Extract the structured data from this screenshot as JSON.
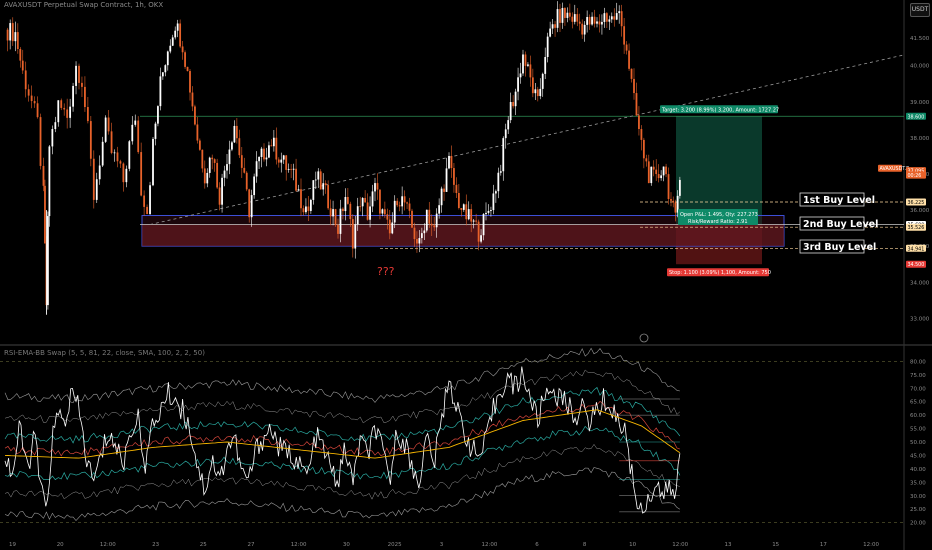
{
  "header": {
    "symbol_title": "AVAXUSDT Perpetual Swap Contract, 1h, OKX",
    "unit": "USDT",
    "indicator_title": "RSI-EMA-BB Swap (5, 5, 81, 22, close, SMA, 100, 2, 2, 50)"
  },
  "colors": {
    "background": "#000000",
    "candle_up": "#ffffff",
    "candle_down": "#e8622a",
    "target_zone": "#0b3f30",
    "target_label_bg": "#0f8a68",
    "stop_zone": "#5a1414",
    "stop_label_bg": "#e53935",
    "buy_zone_border": "#3d4fd6",
    "annotation_red": "#e53935",
    "rsi_line": "#ffffff",
    "basis_line": "#f5b400",
    "band_inner": "#2aa9a0",
    "band_outer": "#9a9a9a",
    "band_red": "#d2453a"
  },
  "price_axis": {
    "ticks": [
      "40.000",
      "39.000",
      "38.000",
      "37.000",
      "36.000",
      "35.000",
      "34.000",
      "33.000"
    ],
    "top_marker": "41.500",
    "badges": [
      {
        "label": "38.600",
        "price": 38.6,
        "color": "#0f8a68",
        "text_color": "#ffffff"
      },
      {
        "label": "AVAXUSDT.P",
        "price": 37.16,
        "color": "#e8622a",
        "text_color": "#ffffff"
      },
      {
        "label": "37.095",
        "price": 37.095,
        "color": "#e8622a",
        "text_color": "#ffffff"
      },
      {
        "label": "00:26",
        "price": 36.97,
        "color": "#e8622a",
        "text_color": "#ffffff"
      },
      {
        "label": "36.225",
        "price": 36.225,
        "color": "#ffe0a8",
        "text_color": "#000000"
      },
      {
        "label": "35.600",
        "price": 35.6,
        "color": "#ffffff",
        "text_color": "#000000"
      },
      {
        "label": "35.526",
        "price": 35.526,
        "color": "#ffe0a8",
        "text_color": "#000000"
      },
      {
        "label": "34.941",
        "price": 34.941,
        "color": "#ffe0a8",
        "text_color": "#000000"
      },
      {
        "label": "34.500",
        "price": 34.5,
        "color": "#e53935",
        "text_color": "#ffffff"
      }
    ]
  },
  "indicator_axis": {
    "ticks": [
      "80.00",
      "75.00",
      "70.00",
      "65.00",
      "60.00",
      "55.00",
      "50.00",
      "45.00",
      "40.00",
      "35.00",
      "30.00",
      "25.00",
      "20.00"
    ]
  },
  "time_axis": {
    "ticks": [
      "19",
      "20",
      "12:00",
      "23",
      "25",
      "27",
      "12:00",
      "30",
      "2025",
      "3",
      "12:00",
      "6",
      "8",
      "10",
      "12:00",
      "13",
      "15",
      "17",
      "12:00"
    ]
  },
  "annotations": {
    "target_label": "Target: 3.200 (8.99%) 3,200, Amount: 1727.27",
    "stop_label": "Stop: 1.100 (3.09%) 1,100, Amount: 750",
    "position_label_line1": "Open P&L: 1.495, Qty: 227.273",
    "position_label_line2": "Risk/Reward Ratio: 2.91",
    "buy_level_1": "1st Buy Level",
    "buy_level_2": "2nd Buy Level",
    "buy_level_3": "3rd Buy Level",
    "question_marks": "???",
    "entry_price": 35.6,
    "target_price": 38.6,
    "stop_price": 34.5,
    "buy_level_1_price": 36.225,
    "buy_level_2_price": 35.526,
    "buy_level_3_price": 34.941,
    "zone_top_price": 35.85,
    "zone_bottom_price": 35.0
  },
  "chart_data": [
    {
      "type": "candlestick",
      "title": "AVAXUSDT Perpetual Swap Contract, 1h, OKX",
      "ylim": [
        32.4,
        41.6
      ],
      "x_categories": [
        "19",
        "20",
        "12:00",
        "23",
        "25",
        "27",
        "12:00",
        "30",
        "2025",
        "3",
        "12:00",
        "6",
        "8",
        "10",
        "12:00",
        "13",
        "15",
        "17",
        "12:00"
      ],
      "close_path": [
        [
          0,
          41.0
        ],
        [
          0.07,
          40.9
        ],
        [
          0.12,
          39.8
        ],
        [
          0.18,
          39.0
        ],
        [
          0.22,
          38.4
        ],
        [
          0.26,
          36.4
        ],
        [
          0.28,
          33.4
        ],
        [
          0.3,
          37.8
        ],
        [
          0.36,
          38.9
        ],
        [
          0.42,
          38.6
        ],
        [
          0.48,
          40.0
        ],
        [
          0.52,
          39.6
        ],
        [
          0.56,
          38.2
        ],
        [
          0.6,
          36.4
        ],
        [
          0.64,
          37.4
        ],
        [
          0.68,
          38.3
        ],
        [
          0.72,
          37.6
        ],
        [
          0.76,
          37.3
        ],
        [
          0.8,
          36.8
        ],
        [
          0.84,
          37.8
        ],
        [
          0.88,
          38.6
        ],
        [
          0.92,
          36.6
        ],
        [
          0.96,
          36.0
        ],
        [
          1.0,
          37.8
        ],
        [
          1.05,
          39.5
        ],
        [
          1.1,
          40.5
        ],
        [
          1.15,
          41.2
        ],
        [
          1.2,
          40.6
        ],
        [
          1.25,
          39.4
        ],
        [
          1.3,
          38.0
        ],
        [
          1.35,
          37.0
        ],
        [
          1.4,
          37.6
        ],
        [
          1.45,
          36.4
        ],
        [
          1.5,
          37.5
        ],
        [
          1.55,
          38.4
        ],
        [
          1.6,
          37.2
        ],
        [
          1.65,
          36.0
        ],
        [
          1.7,
          37.2
        ],
        [
          1.75,
          37.6
        ],
        [
          1.8,
          37.9
        ],
        [
          1.85,
          37.5
        ],
        [
          1.9,
          37.2
        ],
        [
          1.95,
          36.9
        ],
        [
          2.0,
          36.3
        ],
        [
          2.05,
          36.0
        ],
        [
          2.1,
          36.9
        ],
        [
          2.15,
          36.6
        ],
        [
          2.2,
          36.1
        ],
        [
          2.25,
          35.5
        ],
        [
          2.3,
          36.4
        ],
        [
          2.35,
          35.2
        ],
        [
          2.4,
          36.3
        ],
        [
          2.45,
          35.9
        ],
        [
          2.5,
          36.6
        ],
        [
          2.55,
          35.9
        ],
        [
          2.6,
          35.3
        ],
        [
          2.65,
          36.4
        ],
        [
          2.7,
          36.2
        ],
        [
          2.75,
          35.5
        ],
        [
          2.8,
          35.0
        ],
        [
          2.85,
          36.0
        ],
        [
          2.9,
          35.4
        ],
        [
          2.95,
          36.5
        ],
        [
          3.0,
          37.3
        ],
        [
          3.05,
          36.4
        ],
        [
          3.1,
          35.9
        ],
        [
          3.15,
          35.7
        ],
        [
          3.2,
          35.4
        ],
        [
          3.25,
          35.8
        ],
        [
          3.3,
          36.4
        ],
        [
          3.35,
          37.3
        ],
        [
          3.4,
          38.6
        ],
        [
          3.45,
          39.3
        ],
        [
          3.5,
          40.3
        ],
        [
          3.55,
          39.6
        ],
        [
          3.6,
          38.9
        ],
        [
          3.65,
          40.4
        ],
        [
          3.7,
          41.1
        ],
        [
          3.75,
          41.4
        ],
        [
          3.8,
          41.4
        ],
        [
          3.85,
          41.3
        ],
        [
          3.9,
          41.1
        ],
        [
          3.95,
          41.2
        ],
        [
          4.0,
          41.1
        ],
        [
          4.05,
          41.4
        ],
        [
          4.1,
          41.3
        ],
        [
          4.15,
          41.4
        ],
        [
          4.2,
          40.5
        ],
        [
          4.25,
          39.0
        ],
        [
          4.3,
          37.8
        ],
        [
          4.35,
          37.0
        ],
        [
          4.4,
          36.8
        ],
        [
          4.45,
          37.3
        ],
        [
          4.5,
          36.2
        ],
        [
          4.53,
          35.7
        ],
        [
          4.56,
          37.1
        ]
      ]
    },
    {
      "type": "line",
      "title": "RSI-EMA-BB Swap (5, 5, 81, 22, close, SMA, 100, 2, 2, 50)",
      "ylim": [
        18,
        82
      ],
      "series": [
        {
          "name": "RSI",
          "color": "#ffffff",
          "points": [
            [
              0,
              45
            ],
            [
              0.05,
              38
            ],
            [
              0.1,
              55
            ],
            [
              0.15,
              40
            ],
            [
              0.2,
              52
            ],
            [
              0.25,
              30
            ],
            [
              0.28,
              24
            ],
            [
              0.32,
              52
            ],
            [
              0.36,
              60
            ],
            [
              0.4,
              57
            ],
            [
              0.45,
              68
            ],
            [
              0.5,
              62
            ],
            [
              0.55,
              44
            ],
            [
              0.6,
              35
            ],
            [
              0.65,
              45
            ],
            [
              0.7,
              54
            ],
            [
              0.75,
              48
            ],
            [
              0.8,
              42
            ],
            [
              0.85,
              55
            ],
            [
              0.9,
              58
            ],
            [
              0.95,
              42
            ],
            [
              1.0,
              56
            ],
            [
              1.05,
              62
            ],
            [
              1.1,
              68
            ],
            [
              1.15,
              66
            ],
            [
              1.2,
              62
            ],
            [
              1.25,
              55
            ],
            [
              1.3,
              42
            ],
            [
              1.35,
              32
            ],
            [
              1.4,
              44
            ],
            [
              1.45,
              35
            ],
            [
              1.5,
              48
            ],
            [
              1.55,
              52
            ],
            [
              1.6,
              38
            ],
            [
              1.65,
              36
            ],
            [
              1.7,
              48
            ],
            [
              1.75,
              52
            ],
            [
              1.8,
              55
            ],
            [
              1.85,
              48
            ],
            [
              1.9,
              46
            ],
            [
              1.95,
              45
            ],
            [
              2.0,
              40
            ],
            [
              2.05,
              38
            ],
            [
              2.1,
              52
            ],
            [
              2.15,
              48
            ],
            [
              2.2,
              40
            ],
            [
              2.25,
              35
            ],
            [
              2.3,
              48
            ],
            [
              2.35,
              34
            ],
            [
              2.4,
              52
            ],
            [
              2.45,
              44
            ],
            [
              2.5,
              56
            ],
            [
              2.55,
              46
            ],
            [
              2.6,
              36
            ],
            [
              2.65,
              54
            ],
            [
              2.7,
              50
            ],
            [
              2.75,
              40
            ],
            [
              2.8,
              36
            ],
            [
              2.85,
              52
            ],
            [
              2.9,
              42
            ],
            [
              2.95,
              58
            ],
            [
              3.0,
              75
            ],
            [
              3.05,
              62
            ],
            [
              3.1,
              55
            ],
            [
              3.15,
              48
            ],
            [
              3.2,
              44
            ],
            [
              3.25,
              50
            ],
            [
              3.3,
              62
            ],
            [
              3.35,
              70
            ],
            [
              3.4,
              74
            ],
            [
              3.45,
              70
            ],
            [
              3.5,
              76
            ],
            [
              3.55,
              66
            ],
            [
              3.6,
              58
            ],
            [
              3.65,
              68
            ],
            [
              3.7,
              70
            ],
            [
              3.75,
              66
            ],
            [
              3.8,
              64
            ],
            [
              3.85,
              60
            ],
            [
              3.9,
              62
            ],
            [
              3.95,
              58
            ],
            [
              4.0,
              62
            ],
            [
              4.05,
              66
            ],
            [
              4.1,
              62
            ],
            [
              4.15,
              58
            ],
            [
              4.2,
              52
            ],
            [
              4.25,
              32
            ],
            [
              4.3,
              24
            ],
            [
              4.35,
              30
            ],
            [
              4.4,
              34
            ],
            [
              4.45,
              30
            ],
            [
              4.5,
              33
            ],
            [
              4.53,
              28
            ],
            [
              4.56,
              46
            ]
          ]
        },
        {
          "name": "EMA",
          "color": "#f5b400",
          "points": [
            [
              0,
              45
            ],
            [
              0.5,
              44
            ],
            [
              1.0,
              48
            ],
            [
              1.5,
              50
            ],
            [
              2.0,
              47
            ],
            [
              2.5,
              44
            ],
            [
              3.0,
              48
            ],
            [
              3.5,
              58
            ],
            [
              4.0,
              62
            ],
            [
              4.3,
              56
            ],
            [
              4.56,
              46
            ]
          ]
        }
      ]
    }
  ]
}
